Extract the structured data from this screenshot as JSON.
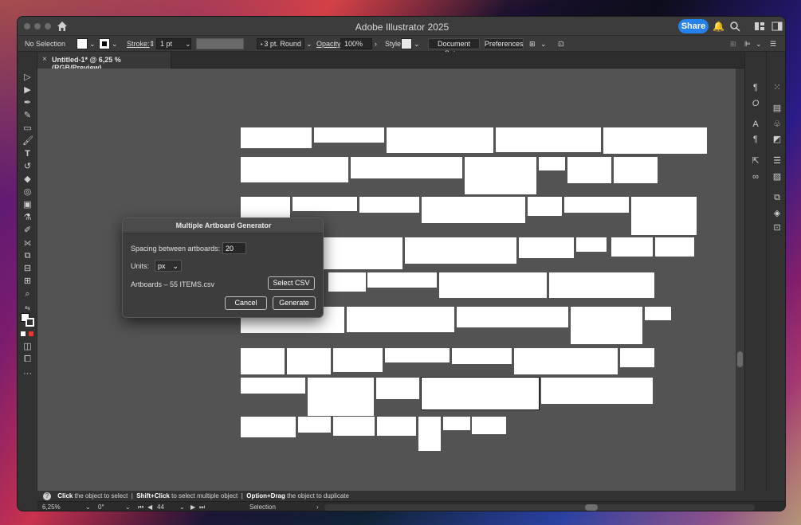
{
  "app": {
    "title": "Adobe Illustrator 2025",
    "share_label": "Share"
  },
  "control_bar": {
    "selection": "No Selection",
    "stroke_label": "Stroke:",
    "stroke_value": "1 pt",
    "brush": "3 pt. Round",
    "opacity_label": "Opacity:",
    "opacity_value": "100%",
    "style_label": "Style:",
    "document_setup": "Document Setup",
    "preferences": "Preferences"
  },
  "tab": {
    "title": "Untitled-1* @ 6,25 % (RGB/Preview)"
  },
  "dialog": {
    "title": "Multiple Artboard Generator",
    "spacing_label": "Spacing between artboards:",
    "spacing_value": "20",
    "units_label": "Units:",
    "units_value": "px",
    "file_label": "Artboards – 55 ITEMS.csv",
    "select_csv": "Select CSV",
    "cancel": "Cancel",
    "generate": "Generate"
  },
  "hint": {
    "click": "Click",
    "t1": "the object to select",
    "shift": "Shift+Click",
    "t2": "to select multiple object",
    "opt": "Option+Drag",
    "t3": "the object to duplicate"
  },
  "status": {
    "zoom": "6,25%",
    "rotation": "0°",
    "artboard": "44",
    "tool": "Selection"
  },
  "icons": [
    "home-icon",
    "bell-icon",
    "search-icon",
    "arrange-icon",
    "panel-icon"
  ],
  "colors": {
    "accent": "#2680eb",
    "canvas": "#535353",
    "artboard": "#ffffff"
  }
}
